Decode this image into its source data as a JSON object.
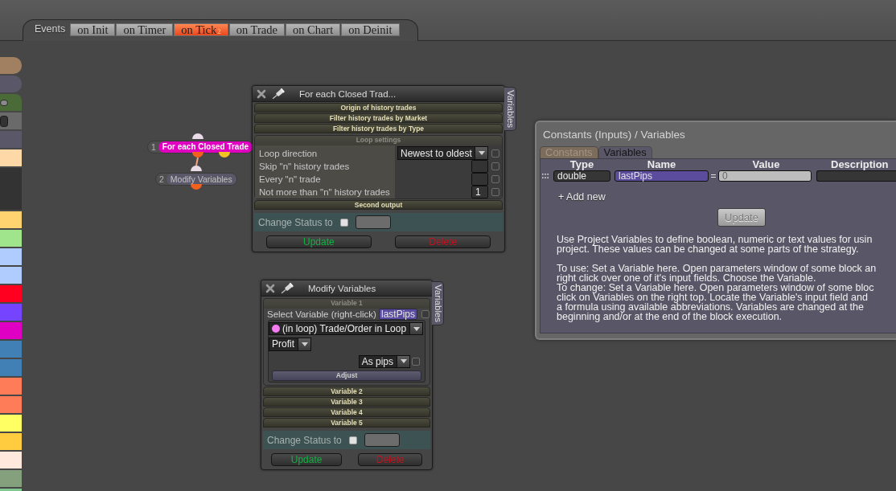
{
  "events_bar": {
    "label": "Events",
    "tabs": [
      {
        "label": "on Init",
        "selected": false
      },
      {
        "label": "on Timer",
        "selected": false
      },
      {
        "label": "on Tick",
        "selected": true,
        "count": "2"
      },
      {
        "label": "on Trade",
        "selected": false
      },
      {
        "label": "on Chart",
        "selected": false
      },
      {
        "label": "on Deinit",
        "selected": false
      }
    ]
  },
  "palette": [
    {
      "kind": "round",
      "color": "#a08060"
    },
    {
      "kind": "round",
      "color": "#5a5868"
    },
    {
      "kind": "pill",
      "color": "#4a6a38"
    },
    {
      "kind": "box",
      "color": "#6a6a6a"
    },
    {
      "kind": "plain",
      "color": "#5a5868"
    },
    {
      "kind": "plain",
      "color": "#ffd8a8"
    },
    {
      "kind": "tall",
      "color": "#333333"
    },
    {
      "kind": "plain",
      "color": "#ffd470"
    },
    {
      "kind": "plain",
      "color": "#a0e48c"
    },
    {
      "kind": "plain",
      "color": "#b0ccff"
    },
    {
      "kind": "plain",
      "color": "#b0ccff"
    },
    {
      "kind": "plain",
      "color": "#ff0020"
    },
    {
      "kind": "plain",
      "color": "#7444ff"
    },
    {
      "kind": "plain",
      "color": "#e000c4"
    },
    {
      "kind": "plain",
      "color": "#4080b4"
    },
    {
      "kind": "plain",
      "color": "#4080b4"
    },
    {
      "kind": "plain",
      "color": "#ff7c58"
    },
    {
      "kind": "plain",
      "color": "#ff7c58"
    },
    {
      "kind": "plain",
      "color": "#ffff64"
    },
    {
      "kind": "plain",
      "color": "#ffcc40"
    },
    {
      "kind": "plain",
      "color": "#ffe8dc"
    },
    {
      "kind": "plain",
      "color": "#84a07c"
    },
    {
      "kind": "plain",
      "color": "#80c890"
    }
  ],
  "nodes": [
    {
      "kind": "loop",
      "number": "1",
      "label": "For each Closed Trade",
      "color": "#e000c0",
      "selected": true
    },
    {
      "kind": "action",
      "number": "2",
      "label": "Modify Variables",
      "color": "#5a5868",
      "selected": false
    }
  ],
  "block_windows": [
    {
      "title": "For each Closed Trad...",
      "side_tab": "Variables",
      "sections": [
        {
          "title": "Origin of history trades",
          "expanded": false
        },
        {
          "title": "Filter history trades by Market",
          "expanded": false
        },
        {
          "title": "Filter history trades by Type",
          "expanded": false
        },
        {
          "title": "Loop settings",
          "expanded": true,
          "rows": [
            {
              "kind": "select",
              "label": "Loop direction",
              "value": "Newest to oldest",
              "checked": false
            },
            {
              "kind": "input",
              "label": "Skip \"n\" history trades",
              "checked": false
            },
            {
              "kind": "input",
              "label": "Every \"n\" trade",
              "checked": false
            },
            {
              "kind": "input",
              "label": "Not more than \"n\" history trades",
              "value": "1",
              "checked": false
            }
          ]
        },
        {
          "title": "Second output",
          "expanded": false
        }
      ],
      "status_label": "Change Status to",
      "status_checked": false,
      "buttons": [
        {
          "kind": "update",
          "label": "Update"
        },
        {
          "kind": "delete",
          "label": "Delete"
        }
      ]
    },
    {
      "title": "Modify Variables",
      "side_tab": "Variables",
      "sections": [
        {
          "title": "Variable 1",
          "expanded": true,
          "editor": {
            "prompt": "Select Variable (right-click)",
            "variable": "lastPips",
            "checked": false,
            "source": "(in loop) Trade/Order in Loop",
            "property": "Profit",
            "format": "As pips",
            "format_checked": false,
            "action": "Adjust"
          }
        },
        {
          "title": "Variable 2",
          "expanded": false
        },
        {
          "title": "Variable 3",
          "expanded": false
        },
        {
          "title": "Variable 4",
          "expanded": false
        },
        {
          "title": "Variable 5",
          "expanded": false
        }
      ],
      "status_label": "Change Status to",
      "status_checked": false,
      "buttons": [
        {
          "kind": "update",
          "label": "Update"
        },
        {
          "kind": "delete",
          "label": "Delete"
        }
      ]
    }
  ],
  "variables_panel": {
    "title": "Constants (Inputs) / Variables",
    "tabs": [
      {
        "label": "Constants",
        "selected": false
      },
      {
        "label": "Variables",
        "selected": true
      }
    ],
    "columns": [
      "Type",
      "Name",
      "Value",
      "Description"
    ],
    "rows": [
      {
        "type": "double",
        "name": "lastPips",
        "operator": "=",
        "value": "0"
      }
    ],
    "add_link": "+ Add new",
    "update_button": "Update",
    "help": [
      [
        "Use Project Variables to define boolean, numeric or text values for usin\nproject. These values can be changed at some parts of the strategy."
      ],
      [
        "To use: Set a Variable here. Open parameters window of some block an\nright click over one of it's input fields. Choose the Variable.",
        "To change: Set a Variable here. Open parameters window of some bloc\nclick on Variables on the right top. Locate the Variable's input field and\na formula using available abbreviations. Variables are changed at the\nbeginning and/or at the end of the block execution."
      ]
    ]
  }
}
